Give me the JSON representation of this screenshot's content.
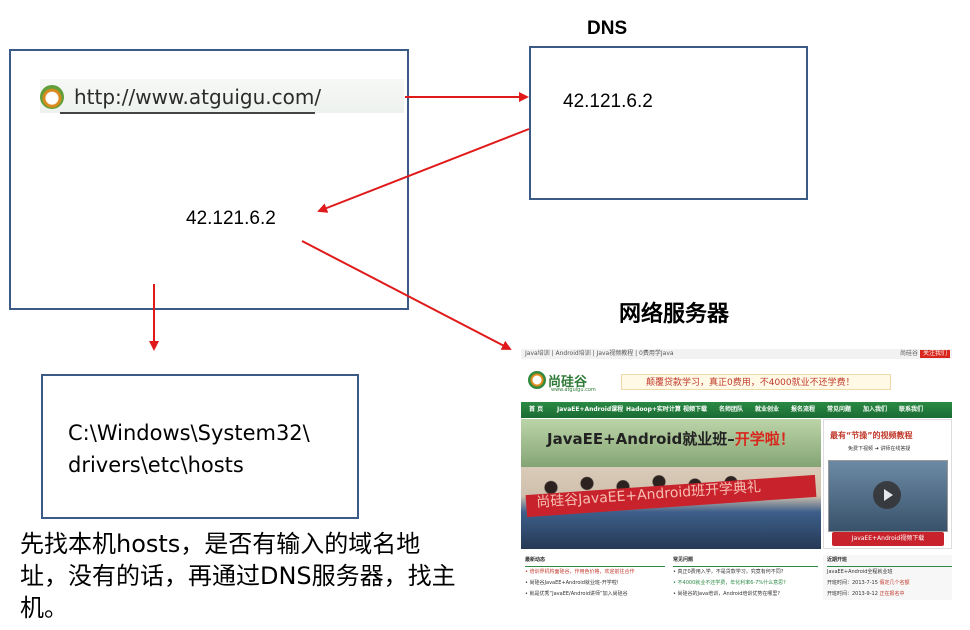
{
  "browser": {
    "url": "http://www.atguigu.com/",
    "ip": "42.121.6.2"
  },
  "dns": {
    "title": "DNS",
    "ip": "42.121.6.2"
  },
  "server": {
    "title": "网络服务器"
  },
  "hosts": {
    "path_line1": "C:\\Windows\\System32\\",
    "path_line2": "drivers\\etc\\hosts"
  },
  "explanation": "先找本机hosts，是否有输入的域名地址，没有的话，再通过DNS服务器，找主机。",
  "colors": {
    "arrow": "#e01a1a",
    "box_border": "#3c5a86"
  },
  "website": {
    "top_nav": "Java培训 | Android培训 | Java视频教程 | 0费用学Java",
    "top_right": "尚硅谷",
    "top_button": "关注我们",
    "brand": "尚硅谷",
    "brand_sub": "www.atguigu.com",
    "slogan": "颠覆贷款学习，真正0费用，不4000就业不还学费！",
    "nav": [
      "首 页",
      "JavaEE+Android课程",
      "Hadoop+实时计算",
      "视频下载",
      "名师团队",
      "就业创业",
      "报名流程",
      "常见问题",
      "加入我们",
      "联系我们"
    ],
    "banner_title": "JavaEE+Android就业班–",
    "banner_title_hl": "开学啦",
    "banner_title_end": "！",
    "banner_red_text": "尚硅谷JavaEE+Android班开学典礼",
    "side_title": "最有“节操”的视频教程",
    "side_sub": "免费下视频 ➜ 讲师在线答疑",
    "side_button": "JavaEE+Android视频下载",
    "col1": {
      "title": "最新动态",
      "items": [
        "• 培训界机构面硅谷，作用色价格，欢迎前往合作",
        "• 尚硅谷JavaEE+Android就业班-开学啦!",
        "• 就是优秀“JavaEE/Android讲师”加入尚硅谷"
      ]
    },
    "col2": {
      "title": "常见问题",
      "items": [
        "• 真正0费用入学，不是贷款学习，究竟有何不同?",
        "• 不4000就业不还学费，年化利率6-7%什么意思?",
        "• 尚硅谷的Java培训，Android培训优势在哪里?"
      ]
    },
    "col3": {
      "title": "近期开班",
      "items": [
        "JavaEE+Android全程就业班",
        "开班时间：2013-7-15",
        "假定几个名额",
        "开班时间：2013-9-12",
        "正在报名中"
      ]
    }
  }
}
